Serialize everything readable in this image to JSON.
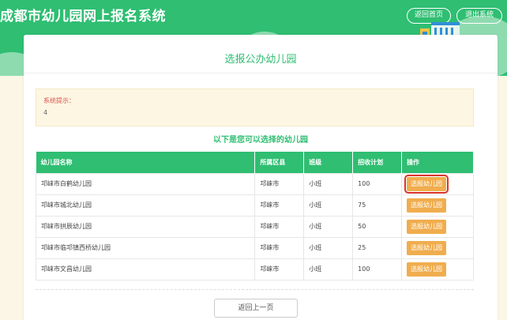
{
  "header": {
    "title": "成都市幼儿园网上报名系统",
    "home_button": "返回首页",
    "logout_button": "退出系统"
  },
  "page": {
    "title": "选报公办幼儿园",
    "notice_label": "系统提示：",
    "notice_value": "4",
    "list_title": "以下是您可以选择的幼儿园",
    "back_button": "返回上一页"
  },
  "table": {
    "headers": [
      "幼儿园名称",
      "所属区县",
      "班级",
      "招收计划",
      "操作"
    ],
    "rows": [
      {
        "name": "邛崃市白鹤幼儿园",
        "district": "邛崃市",
        "class": "小班",
        "plan": "100",
        "action": "选报幼儿园"
      },
      {
        "name": "邛崃市城北幼儿园",
        "district": "邛崃市",
        "class": "小班",
        "plan": "75",
        "action": "选报幼儿园"
      },
      {
        "name": "邛崃市拱辰幼儿园",
        "district": "邛崃市",
        "class": "小班",
        "plan": "50",
        "action": "选报幼儿园"
      },
      {
        "name": "邛崃市临邛镇西桥幼儿园",
        "district": "邛崃市",
        "class": "小班",
        "plan": "25",
        "action": "选报幼儿园"
      },
      {
        "name": "邛崃市文昌幼儿园",
        "district": "邛崃市",
        "class": "小班",
        "plan": "100",
        "action": "选报幼儿园"
      }
    ]
  },
  "colors": {
    "brand_green": "#2fbe72",
    "action_orange": "#f0ad4e",
    "notice_red": "#d9534f",
    "highlight_red": "#d9342b"
  }
}
